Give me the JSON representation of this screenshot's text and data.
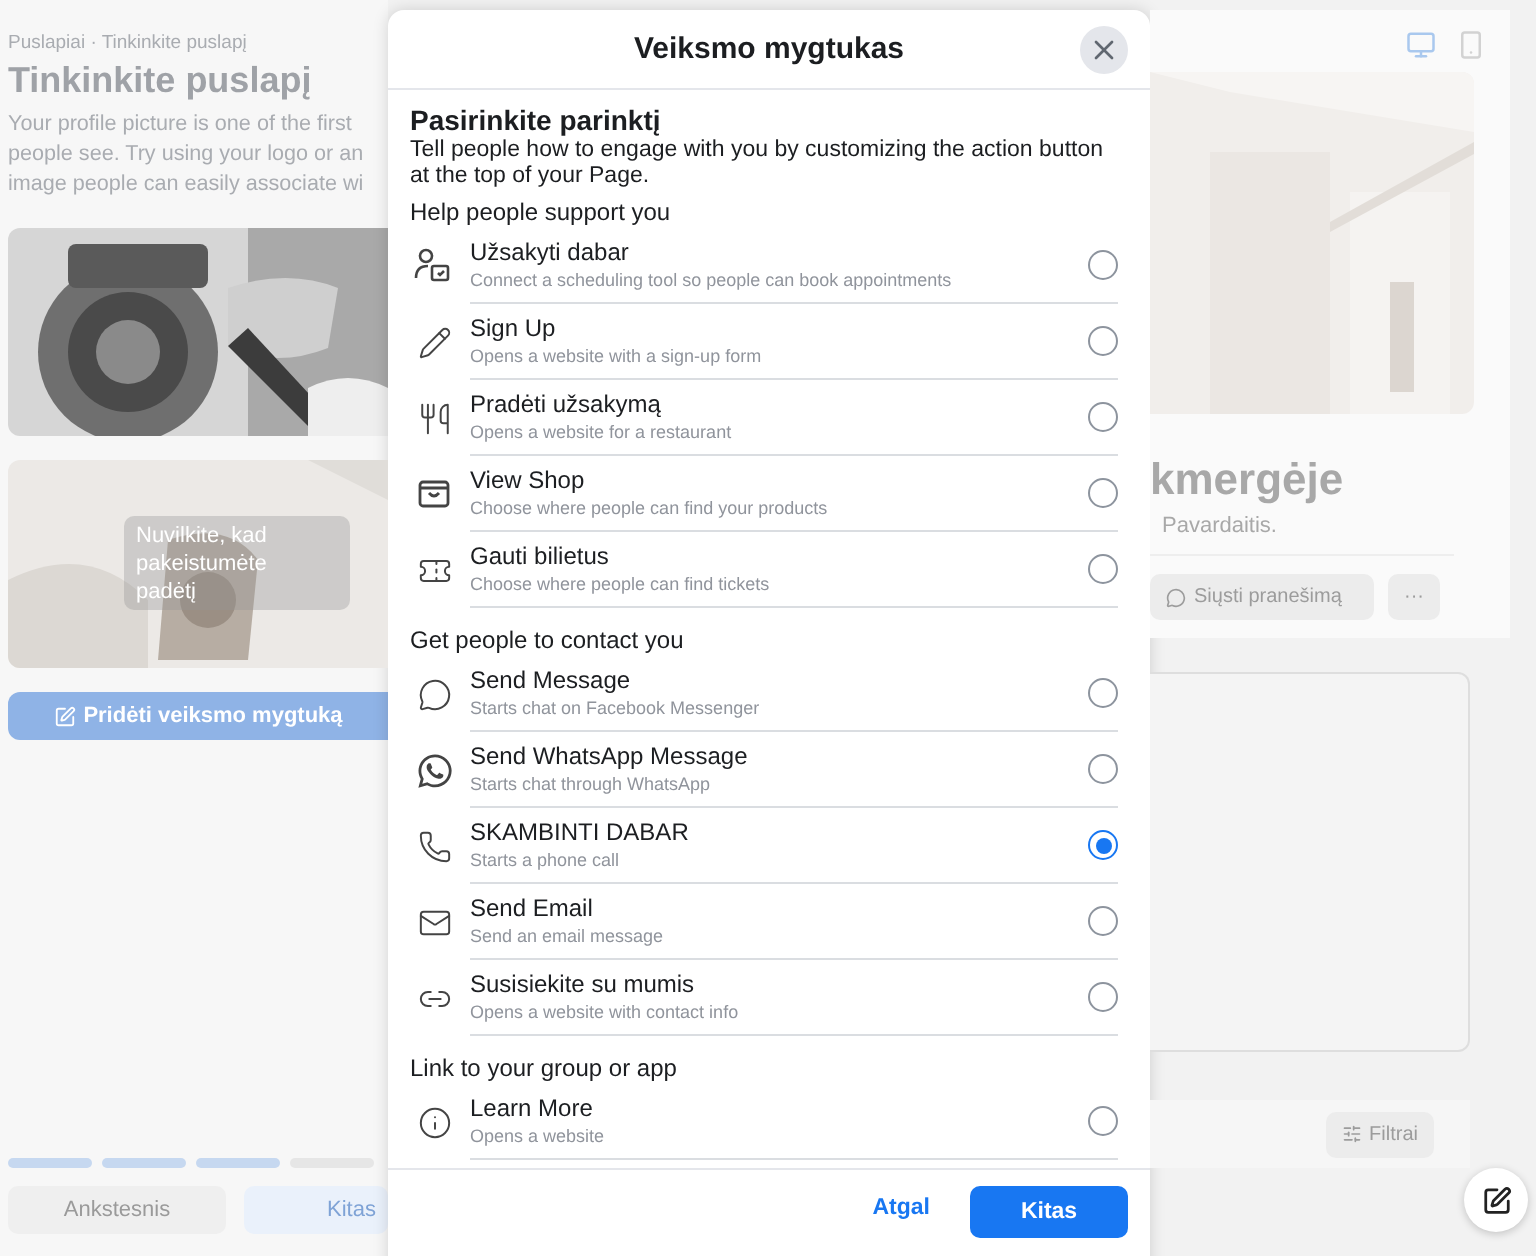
{
  "left_panel": {
    "breadcrumb": "Puslapiai · Tinkinkite puslapį",
    "title": "Tinkinkite puslapį",
    "description_lines": [
      "Your profile picture is one of the first",
      "people see. Try using your logo or an",
      "image people can easily associate wi"
    ],
    "profile_photo": {
      "kind": "picture"
    },
    "cover_photo": {
      "kind": "picture",
      "drag_hint": [
        "Nuvilkite, kad",
        "pakeistumėte",
        "padėtį"
      ]
    },
    "add_button": "Pridėti veiksmo mygtuką",
    "progress": [
      {
        "done": true
      },
      {
        "done": true
      },
      {
        "done": true
      },
      {
        "done": false
      }
    ],
    "prev_button": "Ankstesnis",
    "next_button": "Kitas"
  },
  "dialog": {
    "title": "Veiksmo mygtukas",
    "heading": "Pasirinkite parinktį",
    "description": "Tell people how to engage with you by customizing the action button at the top of your Page.",
    "sections": [
      {
        "title": "Help people support you",
        "options": [
          {
            "label": "Užsakyti dabar",
            "hint": "Connect a scheduling tool so people can book appointments",
            "selected": false
          },
          {
            "label": "Sign Up",
            "hint": "Opens a website with a sign-up form",
            "selected": false
          },
          {
            "label": "Pradėti užsakymą",
            "hint": "Opens a website for a restaurant",
            "selected": false
          },
          {
            "label": "View Shop",
            "hint": "Choose where people can find your products",
            "selected": false
          },
          {
            "label": "Gauti bilietus",
            "hint": "Choose where people can find tickets",
            "selected": false
          }
        ]
      },
      {
        "title": "Get people to contact you",
        "options": [
          {
            "label": "Send Message",
            "hint": "Starts chat on Facebook Messenger",
            "selected": false
          },
          {
            "label": "Send WhatsApp Message",
            "hint": "Starts chat through WhatsApp",
            "selected": false
          },
          {
            "label": "SKAMBINTI DABAR",
            "hint": "Starts a phone call",
            "selected": true
          },
          {
            "label": "Send Email",
            "hint": "Send an email message",
            "selected": false
          },
          {
            "label": "Susisiekite su mumis",
            "hint": "Opens a website with contact info",
            "selected": false
          }
        ]
      },
      {
        "title": "Link to your group or app",
        "options": [
          {
            "label": "Learn More",
            "hint": "Opens a website",
            "selected": false
          }
        ]
      }
    ],
    "back_button": "Atgal",
    "next_button": "Kitas"
  },
  "preview": {
    "devices": [
      {
        "kind": "desktop",
        "selected": true
      },
      {
        "kind": "phone",
        "selected": false
      }
    ],
    "cover_photo": {
      "kind": "picture"
    },
    "page_name": "kmergėje",
    "subtitle": "Pavardaitis.",
    "message_button": "Siųsti pranešimą",
    "more_button": "···",
    "filter_button": "Filtrai"
  }
}
